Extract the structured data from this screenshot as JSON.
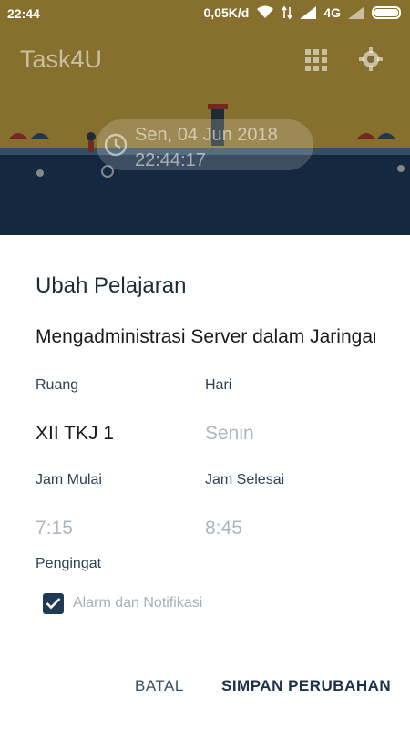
{
  "status_bar": {
    "time": "22:44",
    "network_speed": "0,05K/d",
    "network_type": "4G",
    "icons": [
      "wifi-icon",
      "data-arrows-icon",
      "signal-icon",
      "signal-icon",
      "battery-icon"
    ]
  },
  "app_bar": {
    "title": "Task4U",
    "actions": [
      "grid-icon",
      "gear-icon"
    ]
  },
  "header": {
    "date": "Sen, 04 Jun 2018",
    "time": "22:44:17",
    "icon": "clock-icon"
  },
  "dialog": {
    "title": "Ubah Pelajaran",
    "subject": "Mengadministrasi Server dalam Jaringan",
    "fields": {
      "room_label": "Ruang",
      "room_value": "XII TKJ 1",
      "day_label": "Hari",
      "day_value": "Senin",
      "start_label": "Jam Mulai",
      "start_value": "7:15",
      "end_label": "Jam Selesai",
      "end_value": "8:45"
    },
    "reminder": {
      "label": "Pengingat",
      "checkbox_label": "Alarm dan Notifikasi",
      "checked": true
    },
    "buttons": {
      "cancel": "BATAL",
      "save": "SIMPAN PERUBAHAN"
    }
  },
  "colors": {
    "sky": "#e9c150",
    "sea": "#24466e",
    "accent": "#1e3a55"
  }
}
